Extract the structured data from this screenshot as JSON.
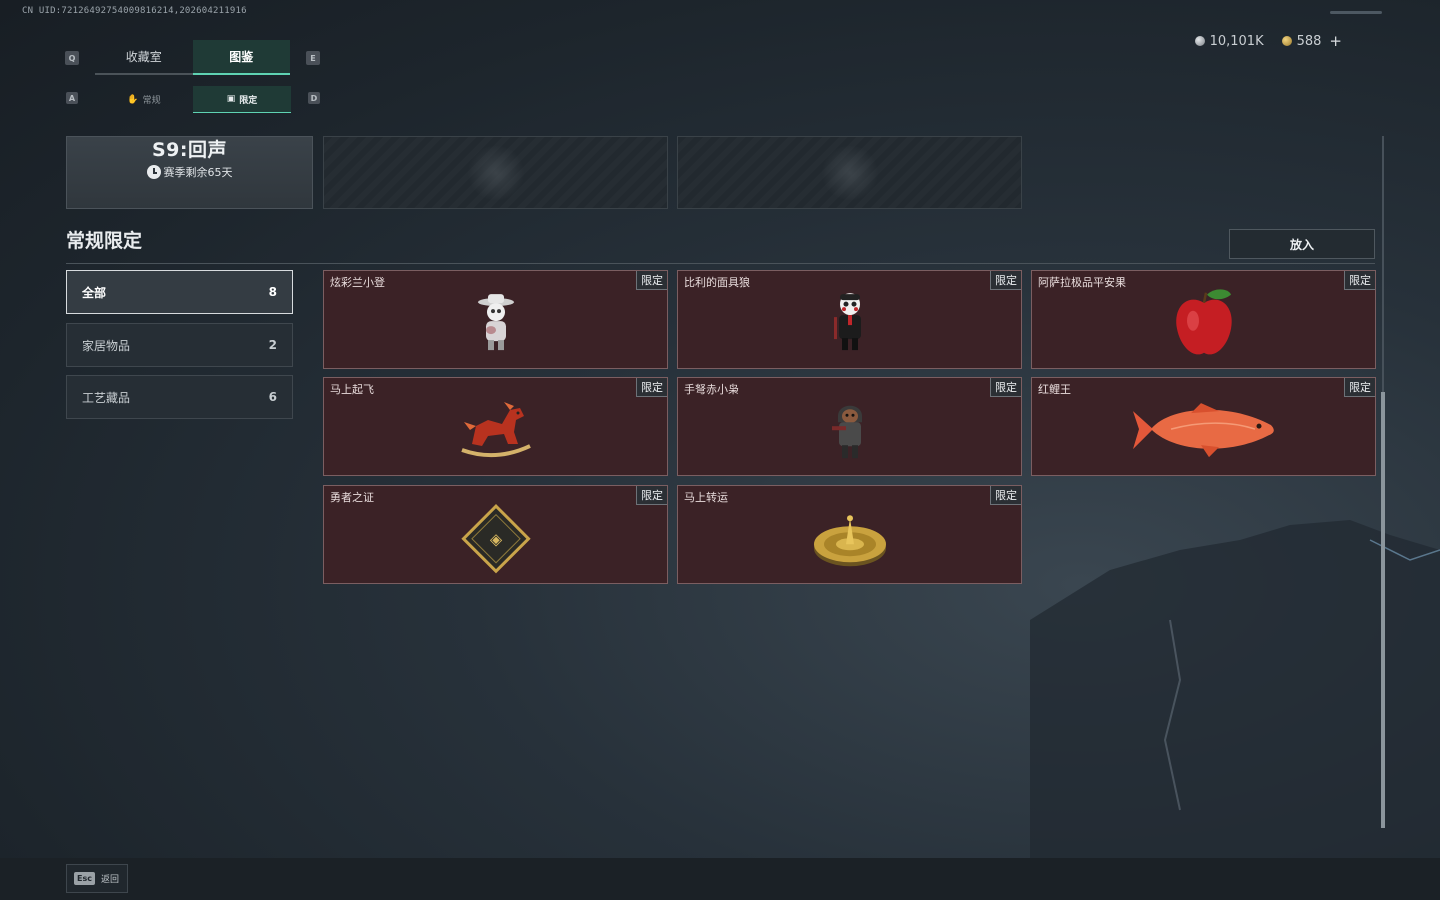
{
  "header": {
    "uid_text": "CN UID:72126492754009816214,202604211916",
    "currency": [
      {
        "icon": "silver-coin-icon",
        "value": "10,101K"
      },
      {
        "icon": "gold-coin-icon",
        "value": "588"
      }
    ],
    "plus_label": "+"
  },
  "keys": {
    "prev_tab": "Q",
    "next_tab": "E",
    "prev_sub": "A",
    "next_sub": "D"
  },
  "tabs": [
    {
      "label": "收藏室",
      "active": false
    },
    {
      "label": "图鉴",
      "active": true
    }
  ],
  "subtabs": [
    {
      "label": "常规",
      "icon": "hand-icon",
      "active": false
    },
    {
      "label": "限定",
      "icon": "frame-icon",
      "active": true
    }
  ],
  "season": {
    "title": "S9:回声",
    "remaining": "赛季剩余65天"
  },
  "section": {
    "title": "常规限定",
    "place_button": "放入"
  },
  "categories": [
    {
      "label": "全部",
      "count": "8",
      "active": true
    },
    {
      "label": "家居物品",
      "count": "2",
      "active": false
    },
    {
      "label": "工艺藏品",
      "count": "6",
      "active": false
    }
  ],
  "items": [
    {
      "name": "炫彩兰小登",
      "tag": "限定",
      "icon": "skeleton-figure-icon"
    },
    {
      "name": "比利的面具狼",
      "tag": "限定",
      "icon": "masked-puppet-icon"
    },
    {
      "name": "阿萨拉极品平安果",
      "tag": "限定",
      "icon": "apple-icon"
    },
    {
      "name": "马上起飞",
      "tag": "限定",
      "icon": "rocking-horse-icon"
    },
    {
      "name": "手弩赤小枭",
      "tag": "限定",
      "icon": "hooded-figure-icon"
    },
    {
      "name": "红鲤王",
      "tag": "限定",
      "icon": "carp-fish-icon"
    },
    {
      "name": "勇者之证",
      "tag": "限定",
      "icon": "card-badge-icon"
    },
    {
      "name": "马上转运",
      "tag": "限定",
      "icon": "golden-compass-icon"
    }
  ],
  "footer": {
    "esc_key": "Esc",
    "back_label": "返回"
  },
  "colors": {
    "accent": "#5fd3b3",
    "card_bg": "#3b2226",
    "card_border": "#7b5e61"
  }
}
